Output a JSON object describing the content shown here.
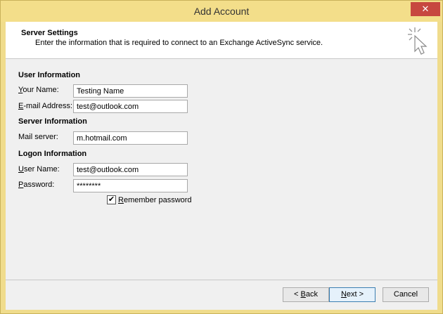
{
  "window": {
    "title": "Add Account",
    "close_glyph": "✕"
  },
  "header": {
    "title": "Server Settings",
    "description": "Enter the information that is required to connect to an Exchange ActiveSync service.",
    "icon": "cursor-click-icon"
  },
  "sections": {
    "user_info": "User Information",
    "server_info": "Server Information",
    "logon_info": "Logon Information"
  },
  "fields": {
    "your_name": {
      "label_first": "Y",
      "label_rest": "our Name:",
      "value": "Testing Name"
    },
    "email": {
      "label_first": "E",
      "label_rest": "-mail Address:",
      "value": "test@outlook.com"
    },
    "mail_server": {
      "label": "Mail server:",
      "value": "m.hotmail.com"
    },
    "user_name": {
      "label_first": "U",
      "label_rest": "ser Name:",
      "value": "test@outlook.com"
    },
    "password": {
      "label_first": "P",
      "label_rest": "assword:",
      "value": "********"
    }
  },
  "remember": {
    "checked_glyph": "✔",
    "label_first": "R",
    "label_rest": "emember password"
  },
  "buttons": {
    "back": {
      "prefix": "< ",
      "underline": "B",
      "rest": "ack"
    },
    "next": {
      "underline": "N",
      "rest": "ext >"
    },
    "cancel": "Cancel"
  }
}
